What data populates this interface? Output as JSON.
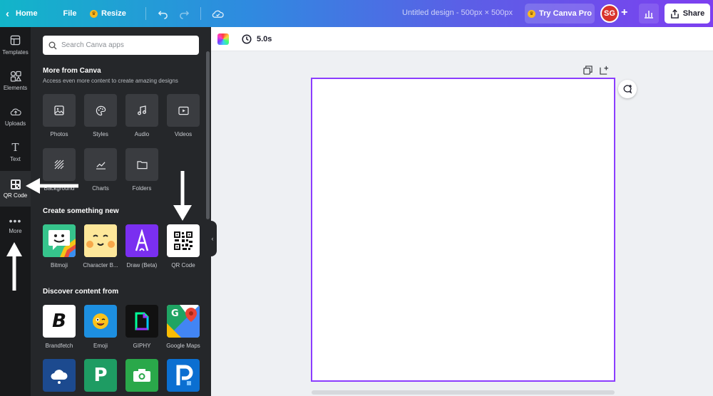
{
  "topbar": {
    "home_label": "Home",
    "file_label": "File",
    "resize_label": "Resize",
    "design_title": "Untitled design - 500px × 500px",
    "try_pro_label": "Try Canva Pro",
    "avatar_initials": "SG",
    "share_label": "Share"
  },
  "rail": {
    "items": [
      {
        "label": "Templates",
        "icon": "templates-icon"
      },
      {
        "label": "Elements",
        "icon": "elements-icon"
      },
      {
        "label": "Uploads",
        "icon": "uploads-icon"
      },
      {
        "label": "Text",
        "icon": "text-icon"
      },
      {
        "label": "QR Code",
        "icon": "qr-code-icon"
      },
      {
        "label": "More",
        "icon": "more-icon"
      }
    ]
  },
  "panel": {
    "search_placeholder": "Search Canva apps",
    "more_title": "More from Canva",
    "more_subtitle": "Access even more content to create amazing designs",
    "more_items": [
      {
        "label": "Photos",
        "icon": "photos-icon"
      },
      {
        "label": "Styles",
        "icon": "styles-icon"
      },
      {
        "label": "Audio",
        "icon": "audio-icon"
      },
      {
        "label": "Videos",
        "icon": "videos-icon"
      },
      {
        "label": "Background",
        "icon": "background-icon"
      },
      {
        "label": "Charts",
        "icon": "charts-icon"
      },
      {
        "label": "Folders",
        "icon": "folders-icon"
      }
    ],
    "create_title": "Create something new",
    "create_items": [
      {
        "label": "Bitmoji",
        "icon": "bitmoji-icon"
      },
      {
        "label": "Character B...",
        "icon": "character-builder-icon"
      },
      {
        "label": "Draw (Beta)",
        "icon": "draw-icon"
      },
      {
        "label": "QR Code",
        "icon": "qr-code-icon"
      }
    ],
    "discover_title": "Discover content from",
    "discover_items": [
      {
        "label": "Brandfetch",
        "icon": "brandfetch-icon"
      },
      {
        "label": "Emoji",
        "icon": "emoji-icon"
      },
      {
        "label": "GIPHY",
        "icon": "giphy-icon"
      },
      {
        "label": "Google Maps",
        "icon": "google-maps-icon"
      }
    ],
    "discover_items_row2": [
      {
        "label": "",
        "icon": "cloud-app-icon"
      },
      {
        "label": "",
        "icon": "p-app-icon"
      },
      {
        "label": "",
        "icon": "photo-app-icon"
      },
      {
        "label": "",
        "icon": "pexels-icon"
      }
    ]
  },
  "editor": {
    "duration": "5.0s"
  },
  "colors": {
    "accent": "#8b3dff",
    "panel_bg": "#25272a",
    "rail_bg": "#18191b"
  }
}
